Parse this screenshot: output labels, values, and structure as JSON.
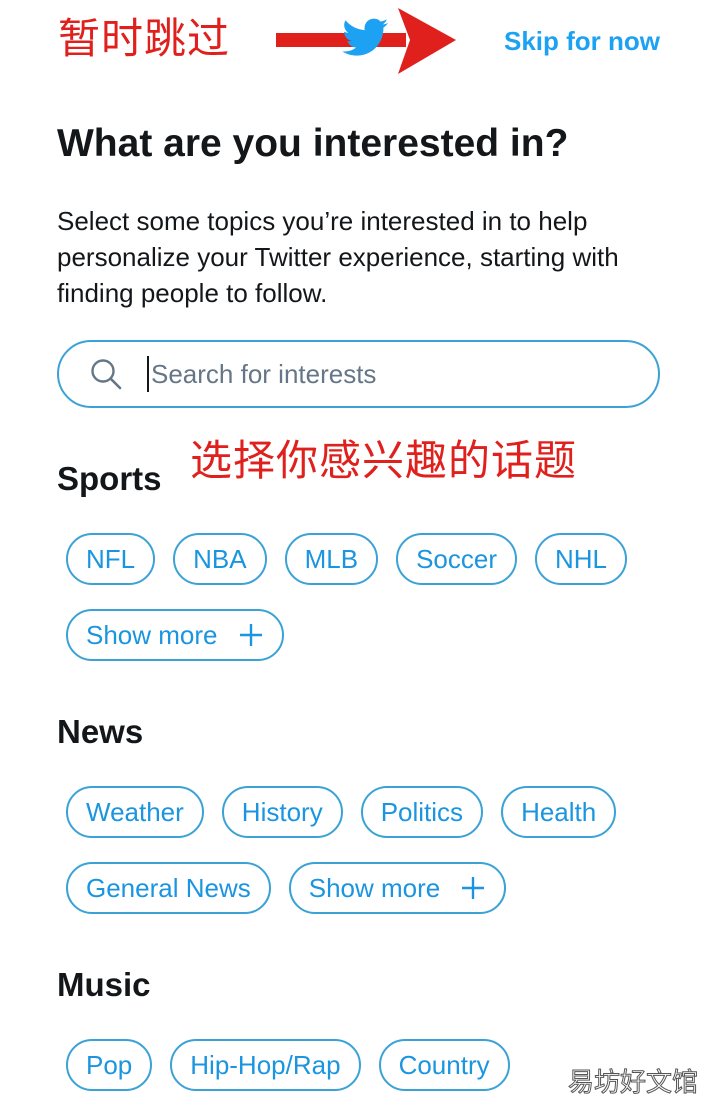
{
  "annotations": {
    "skip_note": "暂时跳过",
    "select_note": "选择你感兴趣的话题"
  },
  "header": {
    "logo_icon": "twitter-bird-icon",
    "skip_label": "Skip for now"
  },
  "page": {
    "title": "What are you interested in?",
    "description": "Select some topics you’re interested in to help personalize your Twitter experience, starting with finding people to follow."
  },
  "search": {
    "placeholder": "Search for interests",
    "value": ""
  },
  "sections": {
    "sports": {
      "title": "Sports",
      "chips": [
        "NFL",
        "NBA",
        "MLB",
        "Soccer",
        "NHL"
      ],
      "show_more": "Show more"
    },
    "news": {
      "title": "News",
      "chips": [
        "Weather",
        "History",
        "Politics",
        "Health",
        "General News"
      ],
      "show_more": "Show more"
    },
    "music": {
      "title": "Music",
      "chips": [
        "Pop",
        "Hip-Hop/Rap",
        "Country"
      ]
    }
  },
  "watermark": "易坊好文馆",
  "colors": {
    "accent": "#1da1f2",
    "chip_border": "#3aa2d6",
    "annotation_red": "#e0201c"
  }
}
